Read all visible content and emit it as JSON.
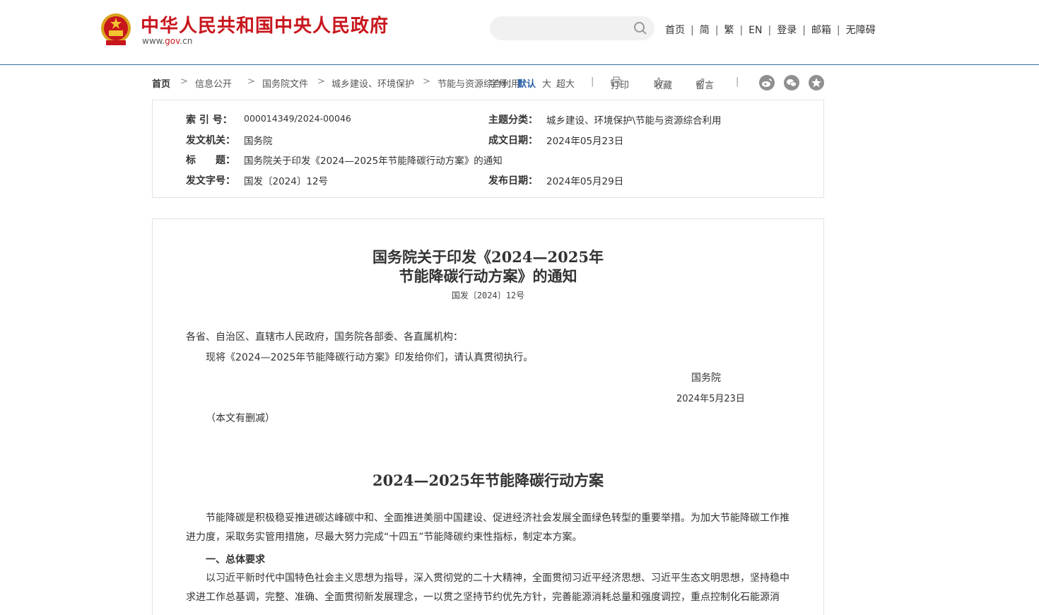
{
  "header": {
    "site_title": "中华人民共和国中央人民政府",
    "site_url_prefix": "www.",
    "site_url_brand": "gov",
    "site_url_suffix": ".cn",
    "search_placeholder": "",
    "nav": [
      "首页",
      "简",
      "繁",
      "EN",
      "登录",
      "邮箱",
      "无障碍"
    ],
    "nav_separator": "|"
  },
  "breadcrumb": {
    "items": [
      "首页",
      "信息公开",
      "国务院文件",
      "城乡建设、环境保护",
      "节能与资源综合利用"
    ],
    "separator": ">"
  },
  "toolbar": {
    "font_label": "字号：",
    "font_default": "默认",
    "font_large": "大",
    "font_xlarge": "超大",
    "divider": "|",
    "print": "打印",
    "favorite": "收藏",
    "comment": "留言"
  },
  "meta": {
    "index_label": "索 引 号：",
    "index_value": "000014349/2024-00046",
    "topic_label": "主题分类：",
    "topic_value": "城乡建设、环境保护\\节能与资源综合利用",
    "issuer_label": "发文机关：",
    "issuer_value": "国务院",
    "written_label": "成文日期：",
    "written_value": "2024年05月23日",
    "title_label": "标　　题：",
    "title_value": "国务院关于印发《2024—2025年节能降碳行动方案》的通知",
    "docno_label": "发文字号：",
    "docno_value": "国发〔2024〕12号",
    "published_label": "发布日期：",
    "published_value": "2024年05月29日"
  },
  "document": {
    "title_line1": "国务院关于印发《2024—2025年",
    "title_line2": "节能降碳行动方案》的通知",
    "doc_number": "国发〔2024〕12号",
    "salutation": "各省、自治区、直辖市人民政府，国务院各部委、各直属机构：",
    "body_line": "现将《2024—2025年节能降碳行动方案》印发给你们，请认真贯彻执行。",
    "signature": "国务院",
    "sign_date": "2024年5月23日",
    "abridged_note": "（本文有删减）",
    "plan_title": "2024—2025年节能降碳行动方案",
    "intro_para": "节能降碳是积极稳妥推进碳达峰碳中和、全面推进美丽中国建设、促进经济社会发展全面绿色转型的重要举措。为加大节能降碳工作推进力度，采取务实管用措施，尽最大努力完成“十四五”节能降碳约束性指标，制定本方案。",
    "section1_heading": "一、总体要求",
    "section1_para": "以习近平新时代中国特色社会主义思想为指导，深入贯彻党的二十大精神，全面贯彻习近平经济思想、习近平生态文明思想，坚持稳中求进工作总基调，完整、准确、全面贯彻新发展理念，一以贯之坚持节约优先方针，完善能源消耗总量和强度调控，重点控制化石能源消"
  },
  "colors": {
    "brand_red": "#c8161d",
    "header_rule": "#3a6f9f",
    "link_blue": "#2b5fa8",
    "share_icon_gray": "#8f8f8f"
  },
  "icons": {
    "emblem": "national-emblem",
    "search": "search-icon",
    "print": "printer-icon",
    "favorite": "star-icon",
    "comment": "pencil-icon",
    "share": [
      "weibo-icon",
      "wechat-icon",
      "favorite-circle-icon"
    ]
  }
}
